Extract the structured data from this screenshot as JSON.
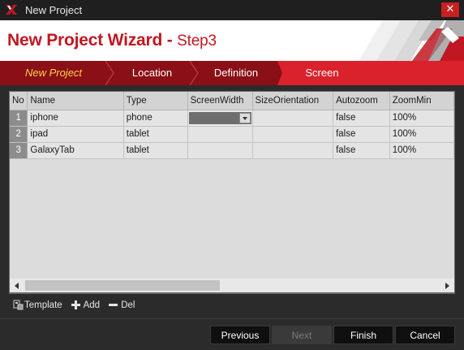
{
  "window": {
    "title": "New Project",
    "close_glyph": "✕"
  },
  "header": {
    "title": "New Project Wizard - ",
    "step": "Step3"
  },
  "steps": [
    {
      "label": "New Project"
    },
    {
      "label": "Location"
    },
    {
      "label": "Definition"
    },
    {
      "label": "Screen"
    }
  ],
  "grid": {
    "columns": [
      "No",
      "Name",
      "Type",
      "ScreenWidth",
      "SizeOrientation",
      "Autozoom",
      "ZoomMin"
    ],
    "rows": [
      {
        "no": "1",
        "name": "iphone",
        "type": "phone",
        "screenwidth": "",
        "sizeorientation": "",
        "autozoom": "false",
        "zoommin": "100%"
      },
      {
        "no": "2",
        "name": "ipad",
        "type": "tablet",
        "screenwidth": "",
        "sizeorientation": "",
        "autozoom": "false",
        "zoommin": "100%"
      },
      {
        "no": "3",
        "name": "GalaxyTab",
        "type": "tablet",
        "screenwidth": "",
        "sizeorientation": "",
        "autozoom": "false",
        "zoommin": "100%"
      }
    ]
  },
  "toolbar": {
    "template": "Template",
    "add": "Add",
    "del": "Del"
  },
  "buttons": {
    "previous": "Previous",
    "next": "Next",
    "finish": "Finish",
    "cancel": "Cancel"
  },
  "colors": {
    "accent": "#c11722",
    "step_bar": "#8a0f16",
    "step_current": "#d9222c",
    "first_step_text": "#ffd24a"
  },
  "icons": [
    "app-logo-icon",
    "close-icon",
    "template-icon",
    "plus-icon",
    "minus-icon",
    "dropdown-arrow-icon",
    "scroll-left-icon",
    "scroll-right-icon"
  ]
}
